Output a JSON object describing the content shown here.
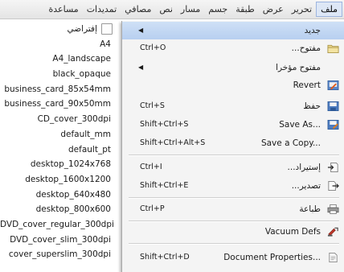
{
  "menubar": {
    "items": [
      {
        "label": "ملف"
      },
      {
        "label": "تحرير"
      },
      {
        "label": "عرض"
      },
      {
        "label": "طبقة"
      },
      {
        "label": "جسم"
      },
      {
        "label": "مسار"
      },
      {
        "label": "نص"
      },
      {
        "label": "مصافي"
      },
      {
        "label": "تمديدات"
      },
      {
        "label": "مساعدة"
      }
    ]
  },
  "templates": {
    "default_folder": "إفتراضي",
    "items": [
      "A4",
      "A4_landscape",
      "black_opaque",
      "business_card_85x54mm",
      "business_card_90x50mm",
      "CD_cover_300dpi",
      "default_mm",
      "default_pt",
      "desktop_1024x768",
      "desktop_1600x1200",
      "desktop_640x480",
      "desktop_800x600",
      "DVD_cover_regular_300dpi",
      "DVD_cover_slim_300dpi",
      "cover_superslim_300dpi"
    ]
  },
  "file_menu": {
    "new": {
      "label": "جديد",
      "arrow": "◀"
    },
    "open": {
      "label": "...مفتوح",
      "shortcut": "Ctrl+O"
    },
    "open_recent": {
      "label": "مفتوح مؤخرا",
      "arrow": "◀"
    },
    "revert": {
      "label": "Revert"
    },
    "save": {
      "label": "حفظ",
      "shortcut": "Ctrl+S"
    },
    "save_as": {
      "label": "Save As...",
      "shortcut": "Shift+Ctrl+S"
    },
    "save_copy": {
      "label": "Save a Copy...",
      "shortcut": "Shift+Ctrl+Alt+S"
    },
    "import": {
      "label": "...إستيراد",
      "shortcut": "Ctrl+I"
    },
    "export": {
      "label": "...تصدير",
      "shortcut": "Shift+Ctrl+E"
    },
    "print": {
      "label": "طباعة",
      "shortcut": "Ctrl+P"
    },
    "vacuum": {
      "label": "Vacuum Defs"
    },
    "document_properties": {
      "label": "Document Properties...",
      "shortcut": "Shift+Ctrl+D"
    }
  },
  "colors": {
    "highlight": "#c4d8f3",
    "menu_bg": "#f4f4f4"
  }
}
